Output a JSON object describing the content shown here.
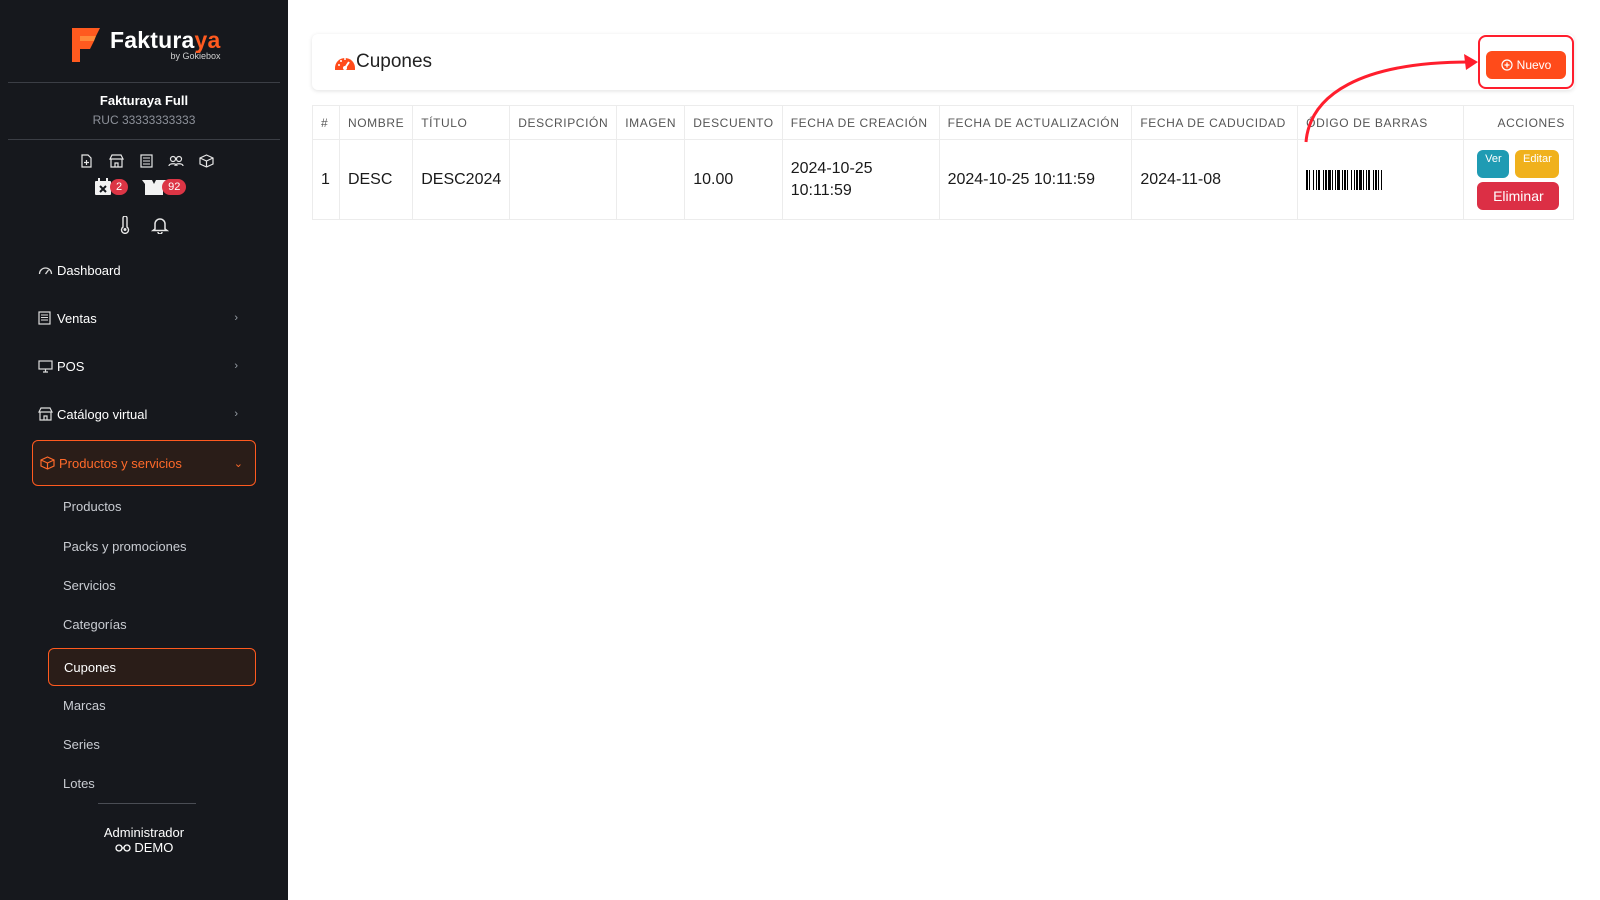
{
  "brand": {
    "name_main": "Fakturaya",
    "name_accent": "ya",
    "name_prefix": "Faktura",
    "by": "by Gokiebox"
  },
  "company": {
    "name": "Fakturaya Full",
    "ruc": "RUC 33333333333"
  },
  "badges": {
    "calendar": "2",
    "box": "92"
  },
  "menu": [
    {
      "label": "Dashboard",
      "icon": "dashboard-icon"
    },
    {
      "label": "Ventas",
      "icon": "receipt-icon"
    },
    {
      "label": "POS",
      "icon": "monitor-icon"
    },
    {
      "label": "Catálogo virtual",
      "icon": "store-icon"
    },
    {
      "label": "Productos y servicios",
      "icon": "box-icon"
    }
  ],
  "submenu": [
    "Productos",
    "Packs y promociones",
    "Servicios",
    "Categorías",
    "Cupones",
    "Marcas",
    "Series",
    "Lotes"
  ],
  "user": {
    "role": "Administrador",
    "name": "DEMO"
  },
  "page": {
    "title": "Cupones",
    "new_button": "Nuevo"
  },
  "table": {
    "headers": [
      "#",
      "NOMBRE",
      "TÍTULO",
      "DESCRIPCIÓN",
      "IMAGEN",
      "DESCUENTO",
      "FECHA DE CREACIÓN",
      "FECHA DE ACTUALIZACIÓN",
      "FECHA DE CADUCIDAD",
      "ÓDIGO DE BARRAS",
      "ACCIONES"
    ],
    "rows": [
      {
        "num": "1",
        "nombre": "DESC",
        "titulo": "DESC2024",
        "descripcion": "",
        "imagen": "",
        "descuento": "10.00",
        "creacion": "2024-10-25 10:11:59",
        "actualizacion": "2024-10-25 10:11:59",
        "caducidad": "2024-11-08"
      }
    ],
    "actions": {
      "view": "Ver",
      "edit": "Editar",
      "delete": "Eliminar"
    }
  },
  "colors": {
    "accent": "#ff4b1a",
    "sidebar": "#16181d",
    "danger": "#dc2f45",
    "info": "#1f9bb3",
    "warning": "#f0b11c"
  }
}
